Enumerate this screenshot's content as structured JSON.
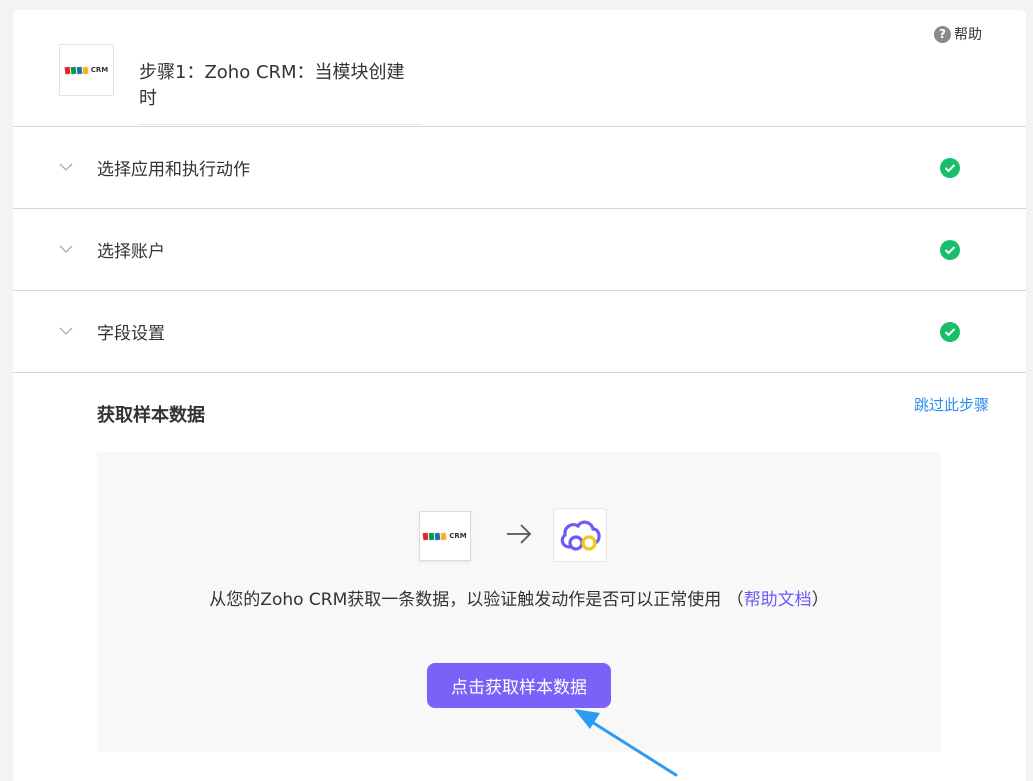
{
  "help": {
    "label": "帮助",
    "icon": "question-icon"
  },
  "step": {
    "logo": {
      "name": "zoho-crm-logo",
      "text": "CRM",
      "colors": [
        "#e42527",
        "#089949",
        "#226db4",
        "#f9b21d"
      ]
    },
    "title": "步骤1：Zoho CRM：当模块创建时"
  },
  "sections": [
    {
      "label": "选择应用和执行动作",
      "status": "check-circle-icon"
    },
    {
      "label": "选择账户",
      "status": "check-circle-icon"
    },
    {
      "label": "字段设置",
      "status": "check-circle-icon"
    }
  ],
  "sample": {
    "title": "获取样本数据",
    "skip_label": "跳过此步骤",
    "description": "从您的Zoho CRM获取一条数据，以验证触发动作是否可以正常使用",
    "paren_open": " （",
    "help_doc_label": "帮助文档",
    "paren_close": "）",
    "button_label": "点击获取样本数据"
  },
  "colors": {
    "accent": "#7b61f8",
    "success": "#19be6b",
    "link": "#2d8cf0",
    "pointer_arrow": "#2b9bf4"
  }
}
